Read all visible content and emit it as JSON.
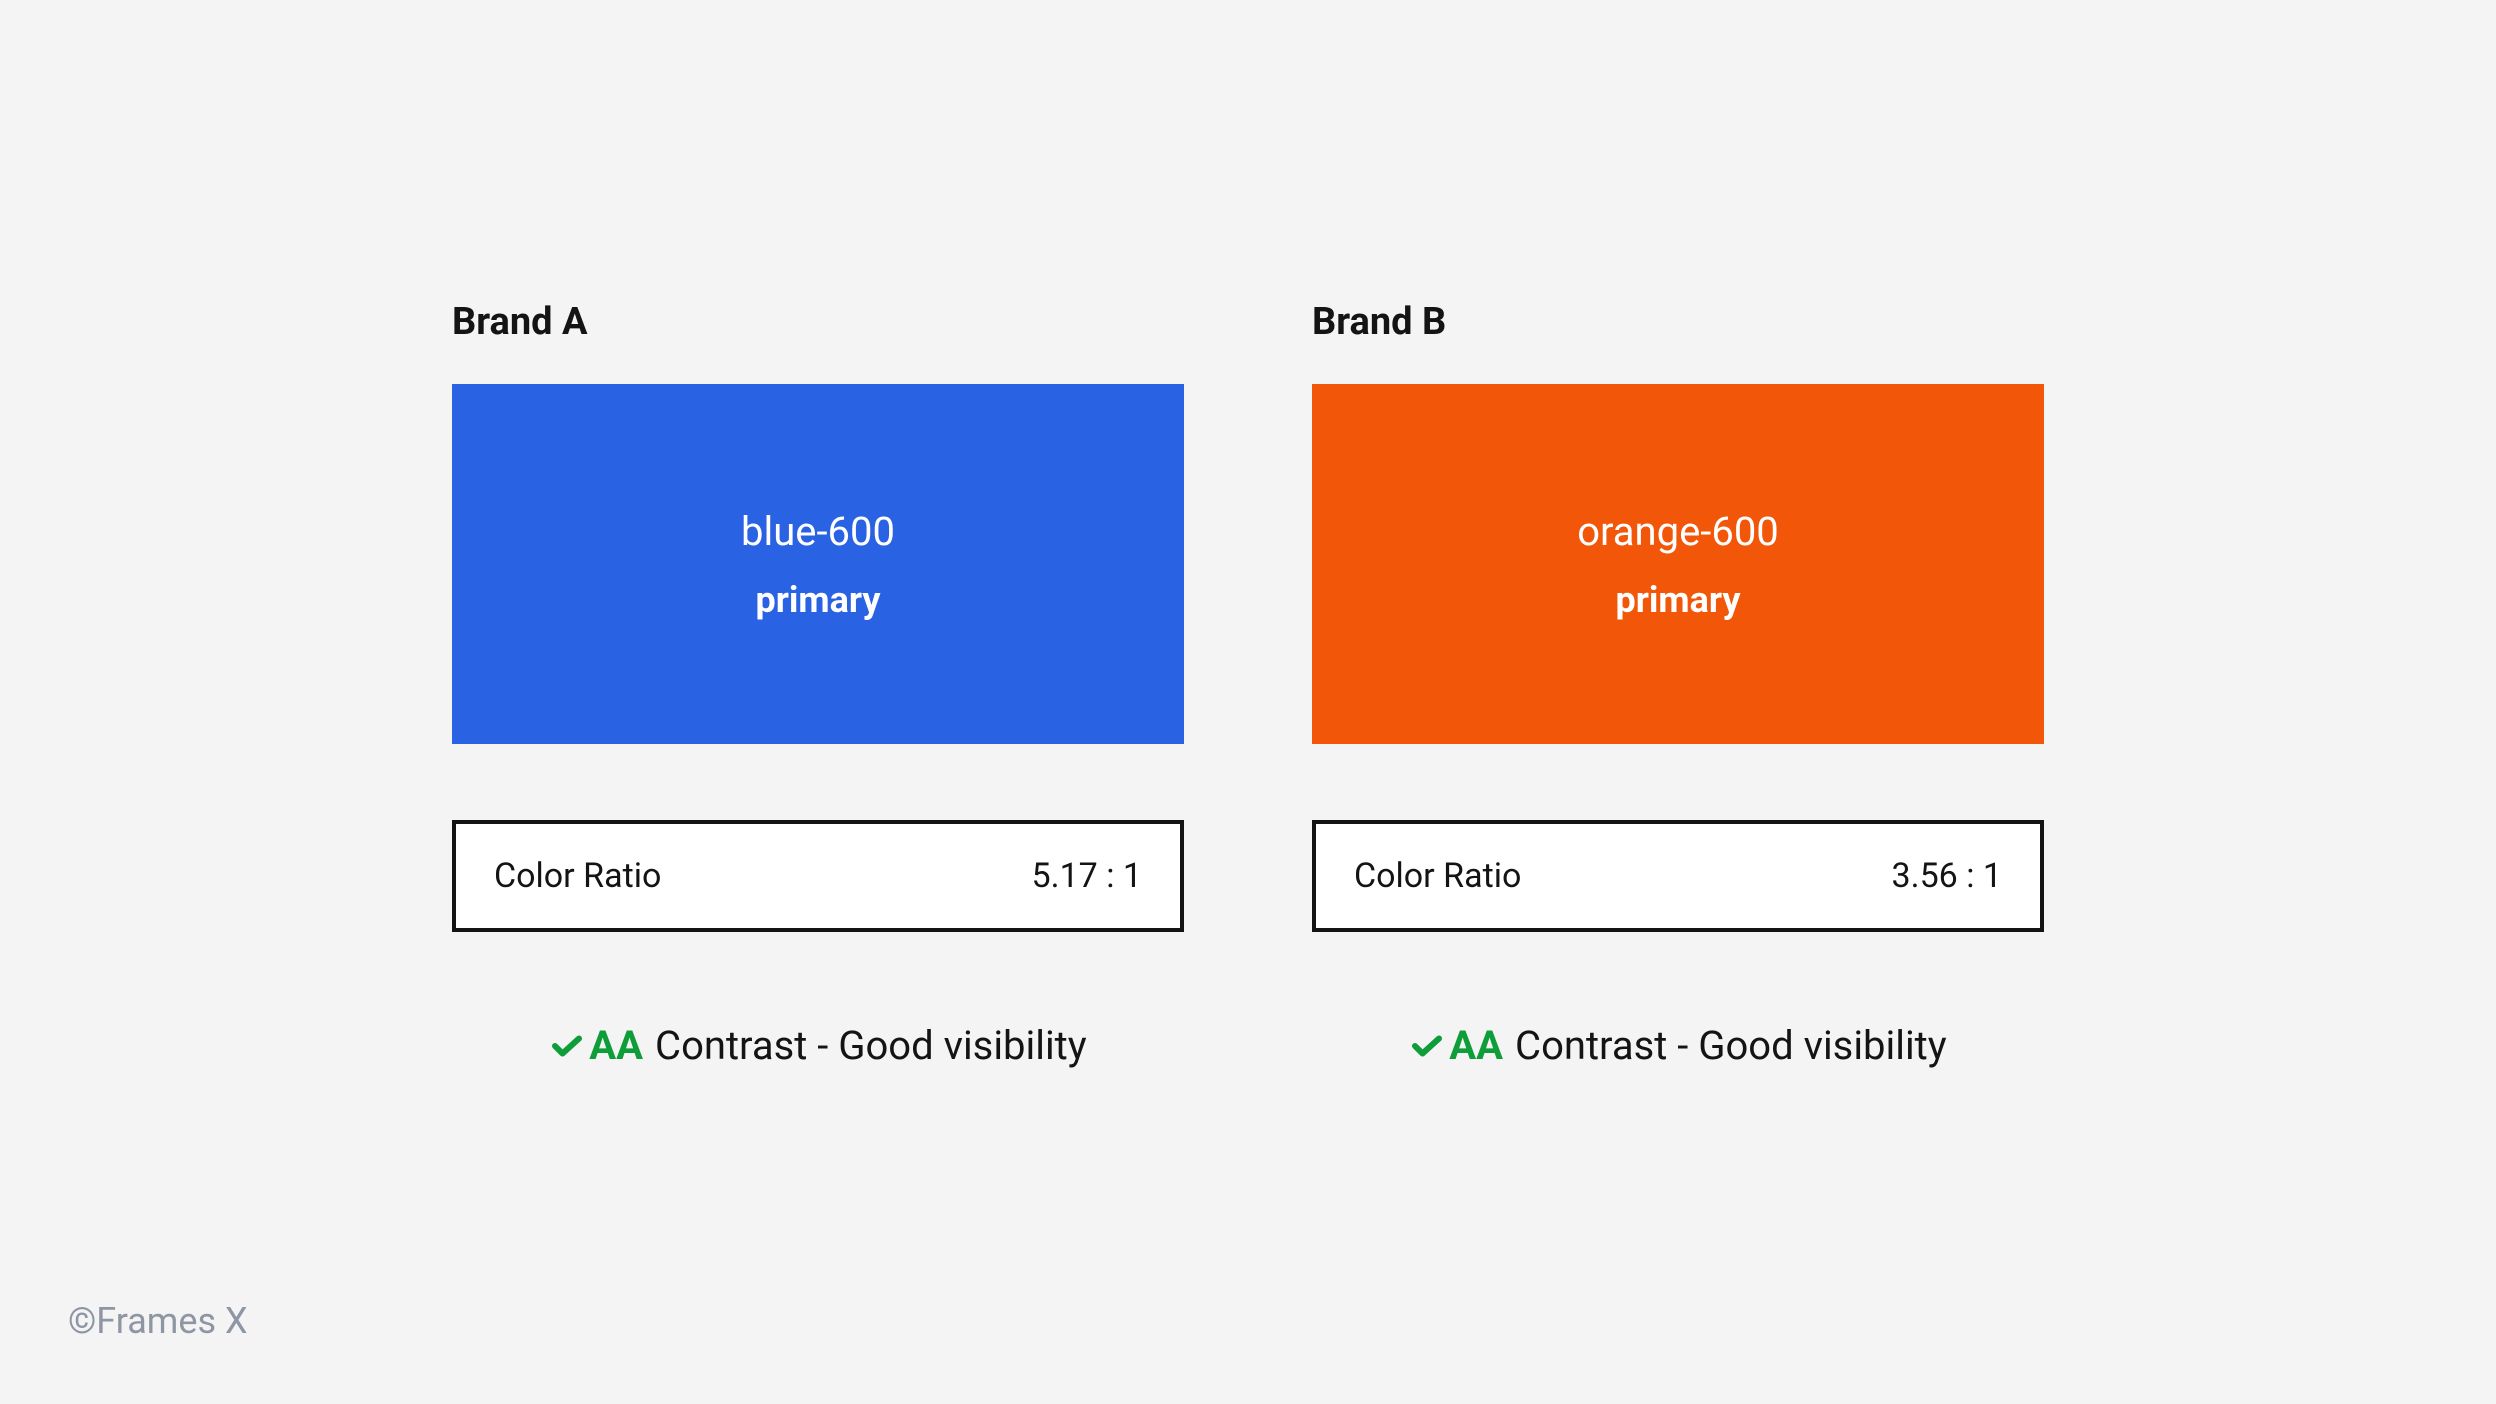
{
  "brands": [
    {
      "title": "Brand A",
      "swatch_name": "blue-600",
      "swatch_role": "primary",
      "swatch_color": "#2962e3",
      "ratio_label": "Color Ratio",
      "ratio_value": "5.17 : 1",
      "aa_level": "AA",
      "contrast_text": "Contrast - Good visibility",
      "accent_color": "#0f9d3a"
    },
    {
      "title": "Brand B",
      "swatch_name": "orange-600",
      "swatch_role": "primary",
      "swatch_color": "#f25608",
      "ratio_label": "Color Ratio",
      "ratio_value": "3.56 : 1",
      "aa_level": "AA",
      "contrast_text": "Contrast - Good visibility",
      "accent_color": "#0f9d3a"
    }
  ],
  "footer": "©Frames X"
}
